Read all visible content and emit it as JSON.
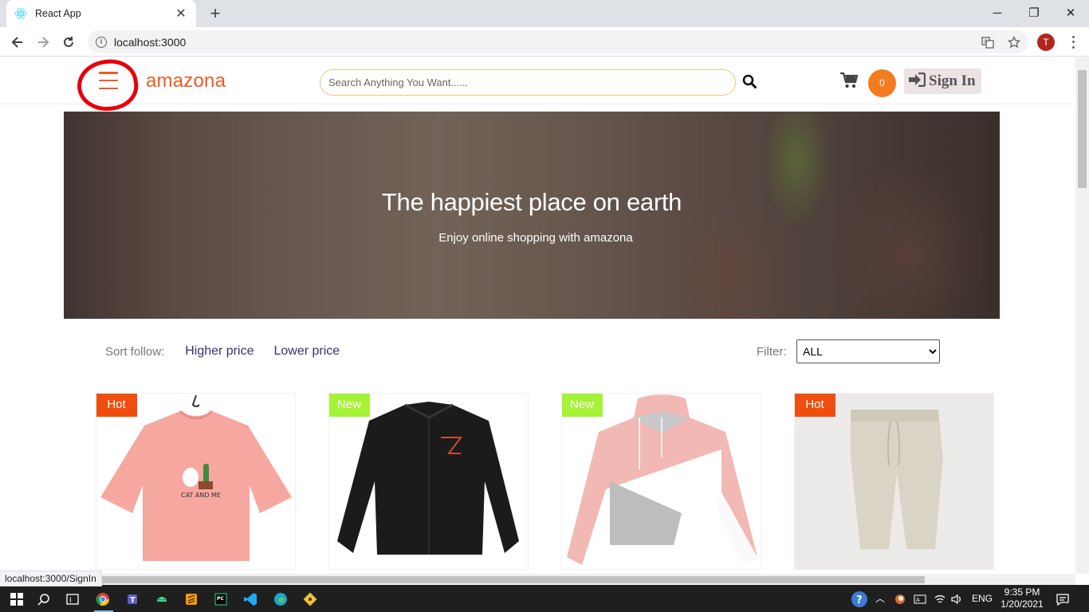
{
  "browser": {
    "tab_title": "React App",
    "url": "localhost:3000",
    "profile_initial": "T",
    "status_url": "localhost:3000/SignIn"
  },
  "header": {
    "logo": "amazona",
    "search_placeholder": "Search Anything You Want......",
    "cart_count": "0",
    "signin_label": "Sign In"
  },
  "hero": {
    "title": "The happiest place on earth",
    "subtitle": "Enjoy online shopping with amazona"
  },
  "sort": {
    "label": "Sort follow:",
    "options": [
      "Higher price",
      "Lower price"
    ]
  },
  "filter": {
    "label": "Filter:",
    "selected": "ALL"
  },
  "products": [
    {
      "badge": "Hot",
      "badge_color": "#f04e0f",
      "item": "pink t-shirt"
    },
    {
      "badge": "New",
      "badge_color": "#a6f236",
      "item": "black jacket"
    },
    {
      "badge": "New",
      "badge_color": "#a6f236",
      "item": "pink hoodie"
    },
    {
      "badge": "Hot",
      "badge_color": "#f04e0f",
      "item": "beige pants"
    }
  ],
  "taskbar": {
    "lang": "ENG",
    "time": "9:35 PM",
    "date": "1/20/2021"
  },
  "colors": {
    "brand": "#f05a23",
    "cart_badge": "#f47b20",
    "link": "#3b2f73"
  }
}
